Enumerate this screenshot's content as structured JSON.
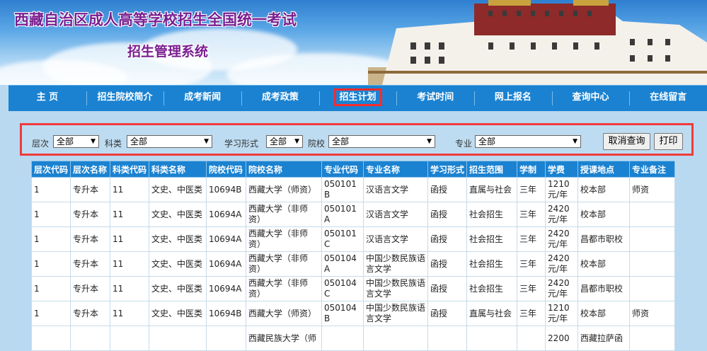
{
  "banner": {
    "title_line1": "西藏自治区成人高等学校招生全国统一考试",
    "title_line2": "招生管理系统"
  },
  "nav": {
    "items": [
      "主 页",
      "招生院校简介",
      "成考新闻",
      "成考政策",
      "招生计划",
      "考试时间",
      "网上报名",
      "查询中心",
      "在线留言"
    ],
    "active_index": 4
  },
  "filter": {
    "level_label": "层次",
    "level_value": "全部",
    "category_label": "科类",
    "category_value": "全部",
    "study_form_label": "学习形式",
    "study_form_value": "全部",
    "school_label": "院校",
    "school_value": "全部",
    "major_label": "专业",
    "major_value": "全部",
    "cancel_button": "取消查询",
    "print_button": "打印"
  },
  "table": {
    "headers": [
      "层次代码",
      "层次名称",
      "科类代码",
      "科类名称",
      "院校代码",
      "院校名称",
      "专业代码",
      "专业名称",
      "学习形式",
      "招生范围",
      "学制",
      "学费",
      "授课地点",
      "专业备注"
    ],
    "rows": [
      [
        "1",
        "专升本",
        "11",
        "文史、中医类",
        "10694B",
        "西藏大学（师资）",
        "050101B",
        "汉语言文学",
        "函授",
        "直属与社会",
        "三年",
        "1210元/年",
        "校本部",
        "师资"
      ],
      [
        "1",
        "专升本",
        "11",
        "文史、中医类",
        "10694A",
        "西藏大学（非师资）",
        "050101A",
        "汉语言文学",
        "函授",
        "社会招生",
        "三年",
        "2420元/年",
        "校本部",
        ""
      ],
      [
        "1",
        "专升本",
        "11",
        "文史、中医类",
        "10694A",
        "西藏大学（非师资）",
        "050101C",
        "汉语言文学",
        "函授",
        "社会招生",
        "三年",
        "2420元/年",
        "昌都市职校",
        ""
      ],
      [
        "1",
        "专升本",
        "11",
        "文史、中医类",
        "10694A",
        "西藏大学（非师资）",
        "050104A",
        "中国少数民族语言文学",
        "函授",
        "社会招生",
        "三年",
        "2420元/年",
        "校本部",
        ""
      ],
      [
        "1",
        "专升本",
        "11",
        "文史、中医类",
        "10694A",
        "西藏大学（非师资）",
        "050104C",
        "中国少数民族语言文学",
        "函授",
        "社会招生",
        "三年",
        "2420元/年",
        "昌都市职校",
        ""
      ],
      [
        "1",
        "专升本",
        "11",
        "文史、中医类",
        "10694B",
        "西藏大学（师资）",
        "050104B",
        "中国少数民族语言文学",
        "函授",
        "直属与社会",
        "三年",
        "1210元/年",
        "校本部",
        "师资"
      ],
      [
        "",
        "",
        "",
        "",
        "",
        "西藏民族大学（师",
        "",
        "",
        "",
        "",
        "",
        "2200",
        "西藏拉萨函",
        ""
      ]
    ]
  }
}
